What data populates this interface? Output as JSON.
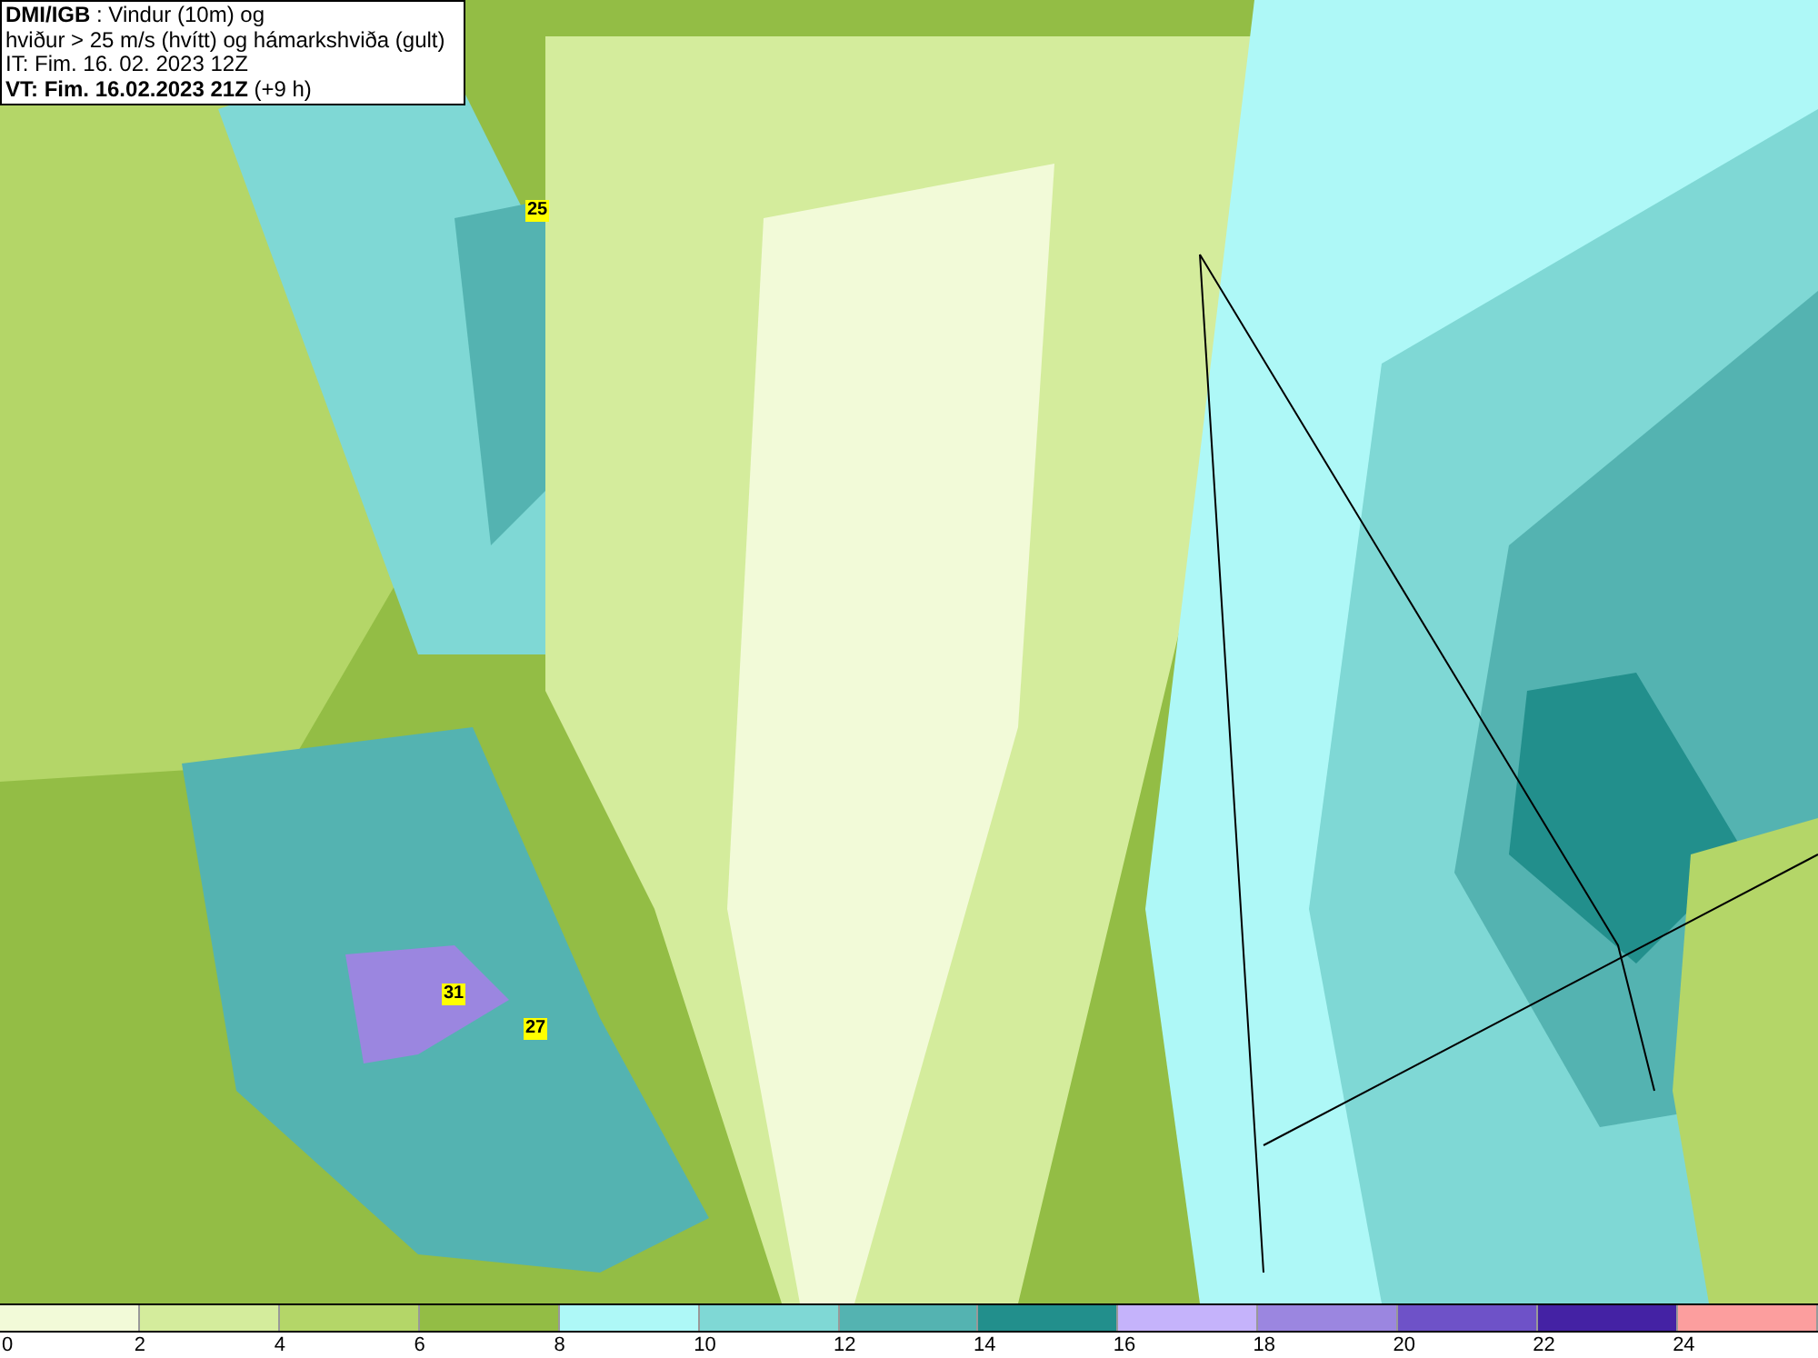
{
  "title_box": {
    "lines": [
      "**DMI/IGB** : Vindur (10m) og",
      "hviður > 25 m/s (hvítt) og hámarkshviða (gult)",
      "IT: Fim. 16. 02. 2023 12Z",
      "**VT: Fim. 16.02.2023 21Z** (+9 h)"
    ]
  },
  "gust_labels": [
    {
      "text": "25"
    },
    {
      "text": "31"
    },
    {
      "text": "27"
    }
  ],
  "legend": {
    "segments": [
      {
        "color": "#f2fad8"
      },
      {
        "color": "#d4ec9c"
      },
      {
        "color": "#b4d668"
      },
      {
        "color": "#93bd45"
      },
      {
        "color": "#aef8f7"
      },
      {
        "color": "#7fd8d5"
      },
      {
        "color": "#54b3b1"
      },
      {
        "color": "#228f8c"
      },
      {
        "color": "#c5b3fb"
      },
      {
        "color": "#9b86e0"
      },
      {
        "color": "#6e52c8"
      },
      {
        "color": "#4422a4"
      },
      {
        "color": "#fc9e9e"
      }
    ],
    "ticks": [
      "0",
      "2",
      "4",
      "6",
      "8",
      "10",
      "12",
      "14",
      "16",
      "18",
      "20",
      "22",
      "24"
    ]
  }
}
